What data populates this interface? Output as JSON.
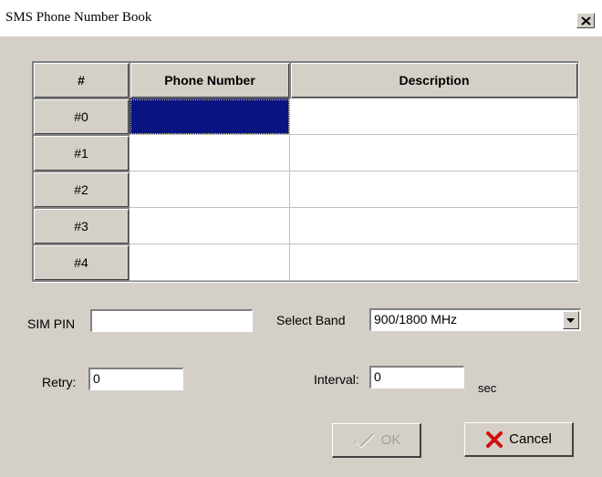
{
  "window": {
    "title": "SMS Phone Number Book",
    "close_glyph": "✕"
  },
  "table": {
    "columns": [
      "#",
      "Phone Number",
      "Description"
    ],
    "rows": [
      {
        "label": "#0",
        "phone": "",
        "description": ""
      },
      {
        "label": "#1",
        "phone": "",
        "description": ""
      },
      {
        "label": "#2",
        "phone": "",
        "description": ""
      },
      {
        "label": "#3",
        "phone": "",
        "description": ""
      },
      {
        "label": "#4",
        "phone": "",
        "description": ""
      }
    ],
    "selection_color": "#0a1480"
  },
  "form": {
    "sim_pin": {
      "label": "SIM PIN",
      "value": ""
    },
    "band": {
      "label": "Select Band",
      "value": "900/1800 MHz"
    },
    "retry": {
      "label": "Retry:",
      "value": "0"
    },
    "interval": {
      "label": "Interval:",
      "value": "0",
      "unit": "sec"
    }
  },
  "buttons": {
    "ok": {
      "label": "OK",
      "icon": "checkmark-icon",
      "disabled": true
    },
    "cancel": {
      "label": "Cancel",
      "icon": "red-x-icon",
      "icon_color": "#d01010"
    }
  }
}
